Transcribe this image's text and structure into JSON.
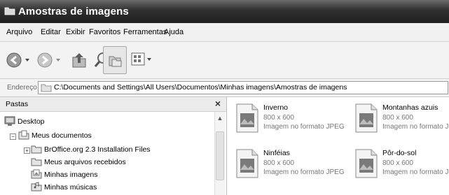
{
  "window": {
    "title": "Amostras de imagens"
  },
  "menu": [
    "Arquivo",
    "Editar",
    "Exibir",
    "Favoritos",
    "Ferramentas",
    "Ajuda"
  ],
  "address": {
    "label": "Endereço",
    "path": "C:\\Documents and Settings\\All Users\\Documentos\\Minhas imagens\\Amostras de imagens"
  },
  "folders_pane": {
    "title": "Pastas",
    "close": "×",
    "items": [
      {
        "label": "Desktop",
        "icon": "desktop-icon"
      },
      {
        "label": "Meus documentos",
        "icon": "folder-icon",
        "expander": "−"
      },
      {
        "label": "BrOffice.org 2.3 Installation Files",
        "icon": "folder-icon",
        "expander": "+"
      },
      {
        "label": "Meus arquivos recebidos",
        "icon": "folder-icon"
      },
      {
        "label": "Minhas imagens",
        "icon": "pictures-folder-icon"
      },
      {
        "label": "Minhas músicas",
        "icon": "music-folder-icon"
      }
    ]
  },
  "files": [
    {
      "name": "Inverno",
      "dimensions": "800 x 600",
      "type": "Imagem no formato JPEG"
    },
    {
      "name": "Montanhas azuis",
      "dimensions": "800 x 600",
      "type": "Imagem no formato JPEG"
    },
    {
      "name": "Ninféias",
      "dimensions": "800 x 600",
      "type": "Imagem no formato JPEG"
    },
    {
      "name": "Pôr-do-sol",
      "dimensions": "800 x 600",
      "type": "Imagem no formato JPEG"
    }
  ],
  "toolbar_icons": [
    "back-icon",
    "forward-icon",
    "up-folder-icon",
    "search-icon",
    "folders-icon",
    "views-icon"
  ]
}
